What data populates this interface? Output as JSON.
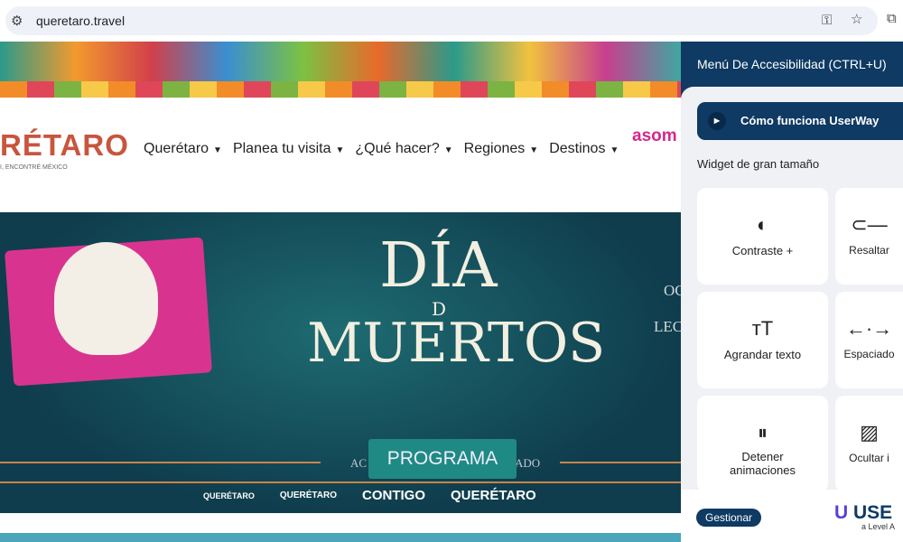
{
  "browser": {
    "url": "queretaro.travel",
    "icons": [
      "site-settings-icon",
      "key-icon",
      "star-icon",
      "extension-icon"
    ]
  },
  "site": {
    "logo": "RÉTARO",
    "logo_tagline": "I, ENCONTRÉ MÉXICO",
    "partner": "asom",
    "nav": [
      {
        "label": "Querétaro"
      },
      {
        "label": "Planea tu visita"
      },
      {
        "label": "¿Qué hacer?"
      },
      {
        "label": "Regiones"
      },
      {
        "label": "Destinos"
      }
    ],
    "hero": {
      "title1": "DÍA",
      "title2": "MUERTOS",
      "connector": "D",
      "side1": "OC",
      "side2": "LEC",
      "acc_left": "AC",
      "acc_right": "ADO",
      "button": "PROGRAMA"
    },
    "footer_logos": [
      "QUERÉTARO",
      "QUERÉTARO",
      "CONTIGO",
      "QUERÉTARO"
    ]
  },
  "panel": {
    "title": "Menú De Accesibilidad (CTRL+U)",
    "how": "Cómo funciona UserWay",
    "widget_label": "Widget de gran tamaño",
    "cards": [
      {
        "label": "Contraste +",
        "icon": "contrast-icon"
      },
      {
        "label": "Resaltar",
        "icon": "link-icon"
      },
      {
        "label": "Agrandar texto",
        "icon": "text-size-icon"
      },
      {
        "label": "Espaciado",
        "icon": "spacing-icon"
      },
      {
        "label": "Detener animaciones",
        "icon": "pause-icon"
      },
      {
        "label": "Ocultar i",
        "icon": "image-icon"
      }
    ],
    "manage": "Gestionar",
    "brand": "USE",
    "brand_sub": "a Level A"
  }
}
